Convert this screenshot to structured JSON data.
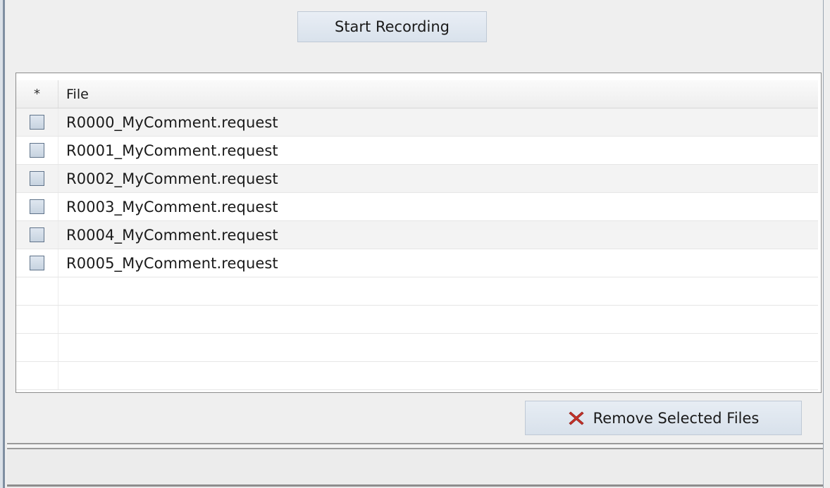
{
  "toolbar": {
    "start_recording_label": "Start Recording"
  },
  "table": {
    "columns": {
      "select": "*",
      "file": "File"
    },
    "rows": [
      {
        "file": "R0000_MyComment.request",
        "checked": false
      },
      {
        "file": "R0001_MyComment.request",
        "checked": false
      },
      {
        "file": "R0002_MyComment.request",
        "checked": false
      },
      {
        "file": "R0003_MyComment.request",
        "checked": false
      },
      {
        "file": "R0004_MyComment.request",
        "checked": false
      },
      {
        "file": "R0005_MyComment.request",
        "checked": false
      }
    ]
  },
  "actions": {
    "remove_selected_label": "Remove Selected Files",
    "remove_icon": "red-x-icon"
  },
  "colors": {
    "remove_icon_red": "#c8322a",
    "button_bg": "#dde5ee"
  }
}
